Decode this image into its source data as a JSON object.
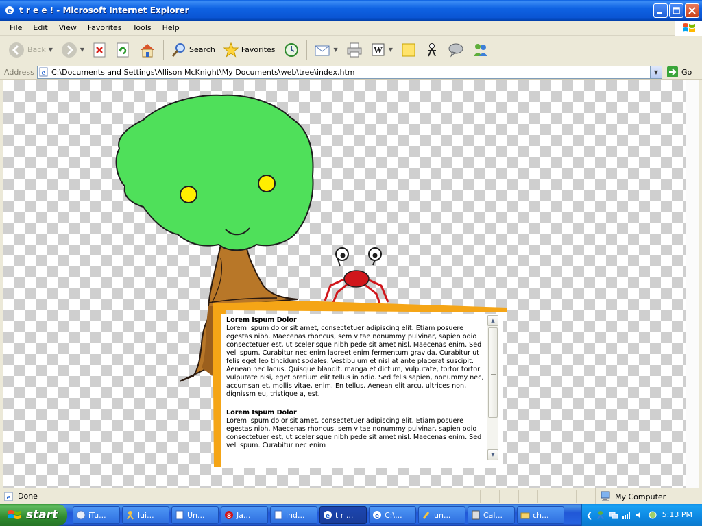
{
  "window": {
    "title": "t r e e ! - Microsoft Internet Explorer"
  },
  "menu": {
    "items": [
      "File",
      "Edit",
      "View",
      "Favorites",
      "Tools",
      "Help"
    ]
  },
  "toolbar": {
    "back_label": "Back",
    "search_label": "Search",
    "favorites_label": "Favorites"
  },
  "address": {
    "label": "Address",
    "url": "C:\\Documents and Settings\\Allison McKnight\\My Documents\\web\\tree\\index.htm",
    "go_label": "Go"
  },
  "page": {
    "sections": [
      {
        "heading": "Lorem Ispum Dolor",
        "body": "Lorem ispum dolor sit amet, consectetuer adipiscing elit. Etiam posuere egestas nibh. Maecenas rhoncus, sem vitae nonummy pulvinar, sapien odio consectetuer est, ut scelerisque nibh pede sit amet nisl. Maecenas enim. Sed vel ispum. Curabitur nec enim laoreet enim fermentum gravida. Curabitur ut felis eget leo tincidunt sodales. Vestibulum et nisl at ante placerat suscipit. Aenean nec lacus. Quisque blandit, manga et dictum, vulputate, tortor tortor vulputate nisi, eget pretium elit tellus in odio. Sed felis sapien, nonummy nec, accumsan et, mollis vitae, enim. En tellus. Aenean elit arcu, ultrices non, dignissm eu, tristique a, est."
      },
      {
        "heading": "Lorem Ispum Dolor",
        "body": "Lorem ispum dolor sit amet, consectetuer adipiscing elit. Etiam posuere egestas nibh. Maecenas rhoncus, sem vitae nonummy pulvinar, sapien odio consectetuer est, ut scelerisque nibh pede sit amet nisl. Maecenas enim. Sed vel ispum. Curabitur nec enim"
      }
    ]
  },
  "status": {
    "text": "Done",
    "zone": "My Computer"
  },
  "taskbar": {
    "start_label": "start",
    "tasks": [
      "iTu...",
      "lui...",
      "Un...",
      "Ja...",
      "ind...",
      "t r ...",
      "C:\\...",
      "un...",
      "Cal...",
      "ch..."
    ],
    "task_badge": "8",
    "active_index": 5,
    "clock": "5:13 PM"
  },
  "colors": {
    "tree_leaves": "#4fe05a",
    "tree_trunk": "#b87728",
    "eyes": "#ffee00",
    "text_box_border": "#f5a516",
    "bug": "#d0161b",
    "checker": "#cfcfcf"
  }
}
